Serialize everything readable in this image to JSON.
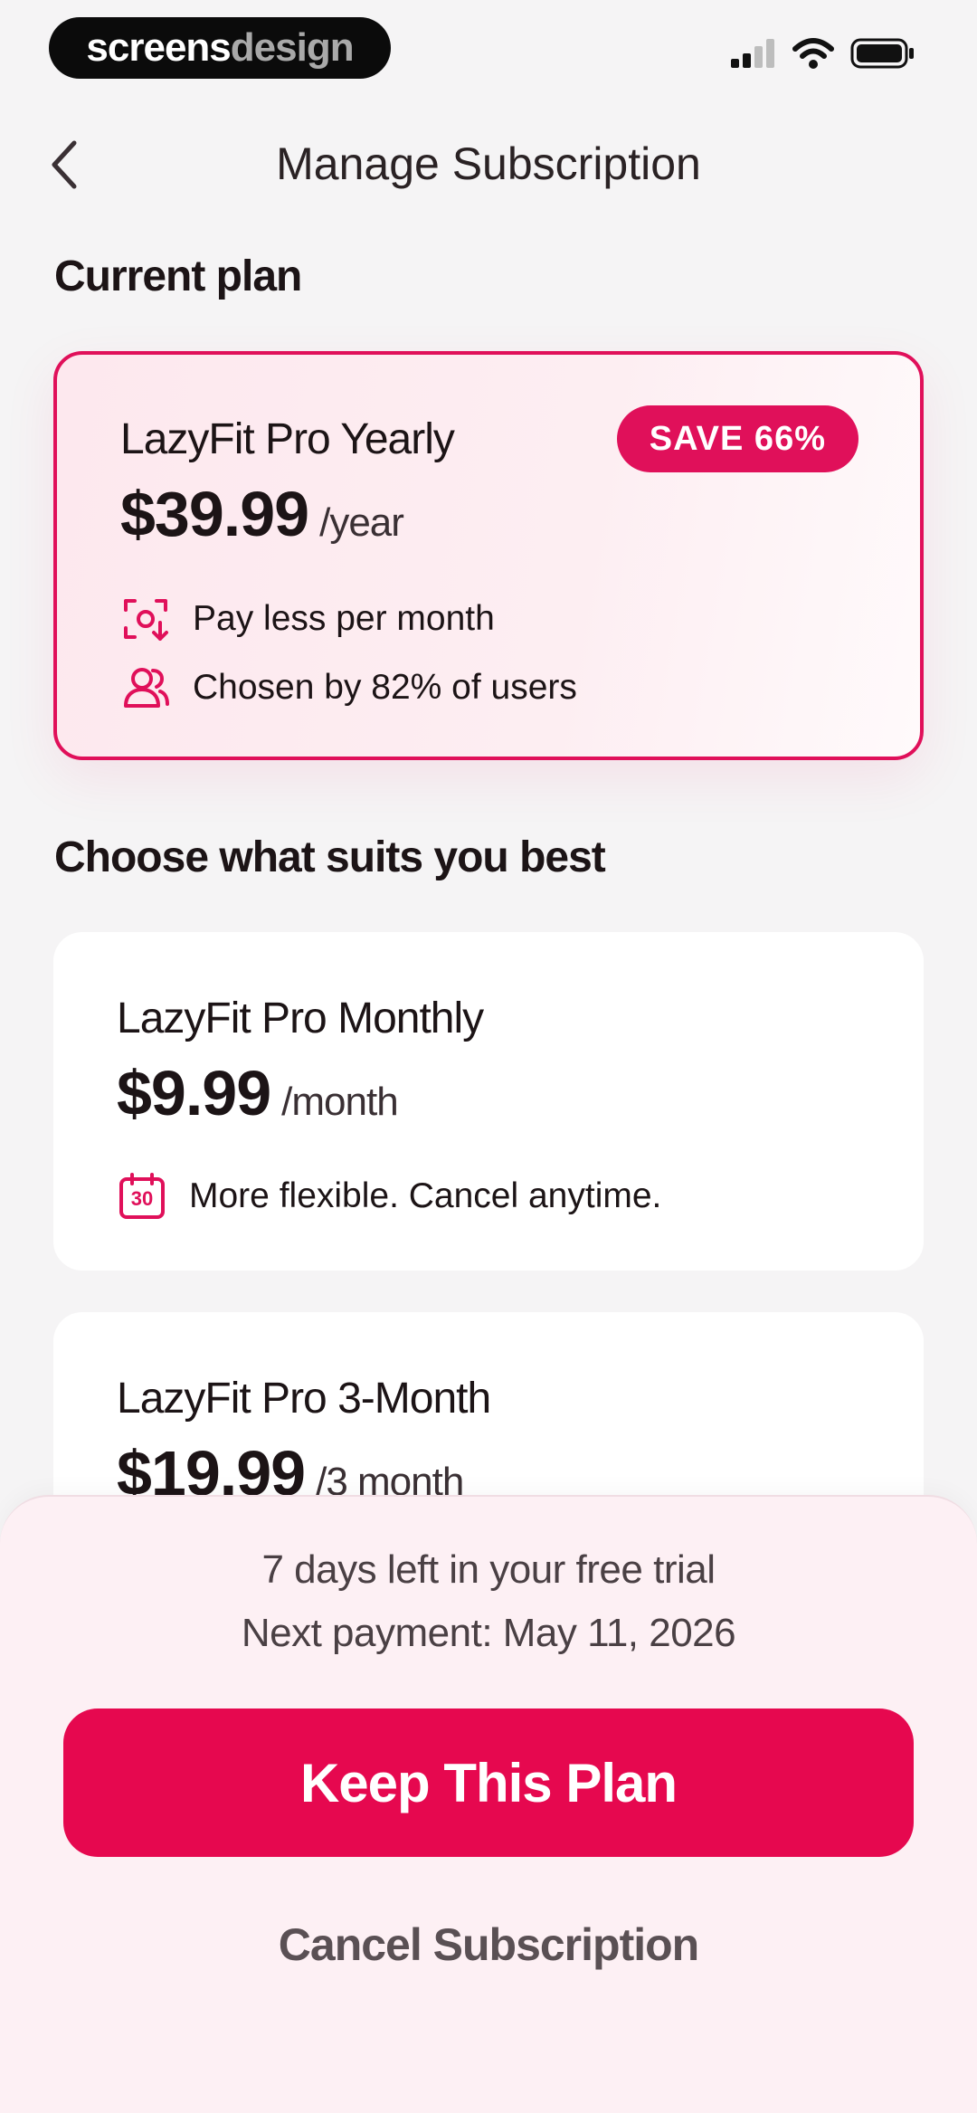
{
  "status_bar": {
    "brand_part1": "screens",
    "brand_part2": "design"
  },
  "header": {
    "title": "Manage Subscription"
  },
  "current_section": {
    "title": "Current plan",
    "plan": {
      "name": "LazyFit Pro Yearly",
      "price": "$39.99",
      "period": "/year",
      "badge": "SAVE 66%",
      "features": [
        {
          "icon": "price-scan-icon",
          "text": "Pay less per month"
        },
        {
          "icon": "users-icon",
          "text": "Chosen by 82% of users"
        }
      ]
    }
  },
  "choose_section": {
    "title": "Choose what suits you best",
    "plans": [
      {
        "name": "LazyFit Pro Monthly",
        "price": "$9.99",
        "period": "/month",
        "features": [
          {
            "icon": "calendar-icon",
            "icon_text": "30",
            "text": "More flexible. Cancel anytime."
          }
        ]
      },
      {
        "name": "LazyFit Pro 3-Month",
        "price": "$19.99",
        "period": "/3 month"
      }
    ]
  },
  "bottom_sheet": {
    "trial_text": "7 days left in your free trial",
    "next_payment": "Next payment: May 11, 2026",
    "keep_label": "Keep This Plan",
    "cancel_label": "Cancel Subscription"
  },
  "colors": {
    "accent": "#e0105a",
    "sheet_bg": "#fdf0f4",
    "page_bg": "#f5f4f5"
  }
}
